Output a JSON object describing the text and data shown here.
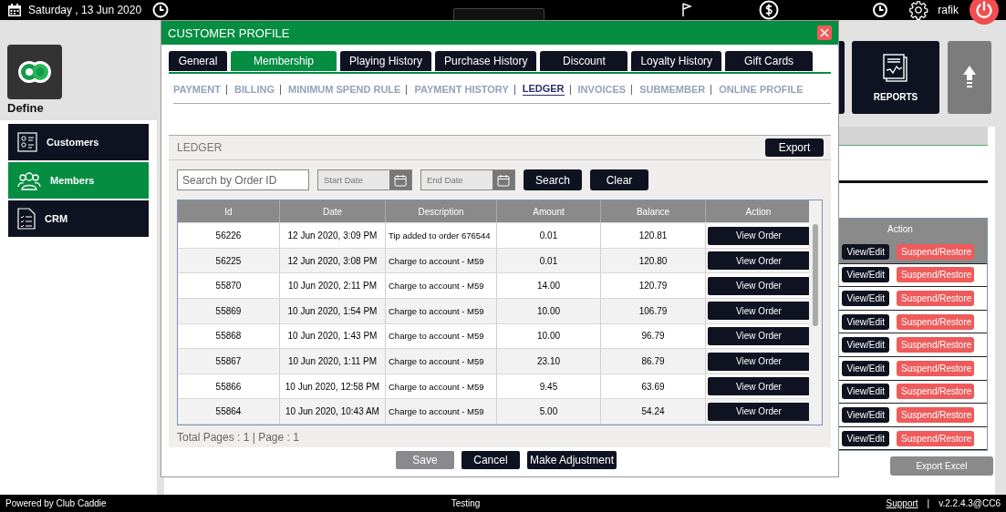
{
  "top_bar": {
    "date": "Saturday ,  13 Jun 2020",
    "user": "rafik"
  },
  "sidebar": {
    "logo_label": "Define",
    "items": [
      {
        "label": "Customers",
        "kind": "card",
        "selected": false
      },
      {
        "label": "Members",
        "kind": "people",
        "selected": true
      },
      {
        "label": "CRM",
        "kind": "checklist",
        "selected": false
      }
    ]
  },
  "tiles": [
    {
      "label": "REPORTS"
    }
  ],
  "members_table": {
    "columns": [
      "Action"
    ],
    "rows": [
      {
        "edit": "View/Edit",
        "suspend": "Suspend/Restore",
        "selected": true
      },
      {
        "edit": "View/Edit",
        "suspend": "Suspend/Restore",
        "selected": false
      },
      {
        "edit": "View/Edit",
        "suspend": "Suspend/Restore",
        "selected": false
      },
      {
        "edit": "View/Edit",
        "suspend": "Suspend/Restore",
        "selected": false
      },
      {
        "edit": "View/Edit",
        "suspend": "Suspend/Restore",
        "selected": false
      },
      {
        "edit": "View/Edit",
        "suspend": "Suspend/Restore",
        "selected": false
      },
      {
        "edit": "View/Edit",
        "suspend": "Suspend/Restore",
        "selected": false
      },
      {
        "edit": "View/Edit",
        "suspend": "Suspend/Restore",
        "selected": false
      },
      {
        "edit": "View/Edit",
        "suspend": "Suspend/Restore",
        "selected": false
      }
    ],
    "export_button": "Export Excel"
  },
  "modal": {
    "title": "CUSTOMER PROFILE",
    "tabs": [
      {
        "label": "General",
        "selected": false
      },
      {
        "label": "Membership",
        "selected": true
      },
      {
        "label": "Playing History",
        "selected": false
      },
      {
        "label": "Purchase History",
        "selected": false
      },
      {
        "label": "Discount",
        "selected": false
      },
      {
        "label": "Loyalty History",
        "selected": false
      },
      {
        "label": "Gift Cards",
        "selected": false
      }
    ],
    "subnav": [
      {
        "label": "PAYMENT",
        "selected": false
      },
      {
        "label": "BILLING",
        "selected": false
      },
      {
        "label": "MINIMUM SPEND RULE",
        "selected": false
      },
      {
        "label": "PAYMENT HISTORY",
        "selected": false
      },
      {
        "label": "LEDGER",
        "selected": true
      },
      {
        "label": "INVOICES",
        "selected": false
      },
      {
        "label": "SUBMEMBER",
        "selected": false
      },
      {
        "label": "ONLINE PROFILE",
        "selected": false
      }
    ],
    "ledger": {
      "title": "LEDGER",
      "export": "Export",
      "search": {
        "placeholder": "Search by Order ID"
      },
      "start_date": {
        "placeholder": "Start Date"
      },
      "end_date": {
        "placeholder": "End Date"
      },
      "search_button": "Search",
      "clear_button": "Clear",
      "table": {
        "columns": [
          "Id",
          "Date",
          "Description",
          "Amount",
          "Balance",
          "Action"
        ],
        "rows": [
          {
            "id": "56226",
            "date": "12 Jun 2020, 3:09 PM",
            "description": "Tip added to order 676544",
            "amount": "0.01",
            "balance": "120.81",
            "action": "View Order"
          },
          {
            "id": "56225",
            "date": "12 Jun 2020, 3:08 PM",
            "description": "Charge to account - M59",
            "amount": "0.01",
            "balance": "120.80",
            "action": "View Order"
          },
          {
            "id": "55870",
            "date": "10 Jun 2020, 2:11 PM",
            "description": "Charge to account - M59",
            "amount": "14.00",
            "balance": "120.79",
            "action": "View Order"
          },
          {
            "id": "55869",
            "date": "10 Jun 2020, 1:54 PM",
            "description": "Charge to account - M59",
            "amount": "10.00",
            "balance": "106.79",
            "action": "View Order"
          },
          {
            "id": "55868",
            "date": "10 Jun 2020, 1:43 PM",
            "description": "Charge to account - M59",
            "amount": "10.00",
            "balance": "96.79",
            "action": "View Order"
          },
          {
            "id": "55867",
            "date": "10 Jun 2020, 1:11 PM",
            "description": "Charge to account - M59",
            "amount": "23.10",
            "balance": "86.79",
            "action": "View Order"
          },
          {
            "id": "55866",
            "date": "10 Jun 2020, 12:58 PM",
            "description": "Charge to account - M59",
            "amount": "9.45",
            "balance": "63.69",
            "action": "View Order"
          },
          {
            "id": "55864",
            "date": "10 Jun 2020, 10:43 AM",
            "description": "Charge to account - M59",
            "amount": "5.00",
            "balance": "54.24",
            "action": "View Order"
          }
        ]
      },
      "pages": "Total Pages : 1 | Page : 1"
    },
    "actions": [
      {
        "label": "Save",
        "disabled": true
      },
      {
        "label": "Cancel",
        "disabled": false
      },
      {
        "label": "Make Adjustment",
        "disabled": false
      }
    ]
  },
  "footer": {
    "left": "Powered by Club Caddie",
    "center": "Testing",
    "support": "Support",
    "separator": "|",
    "version": "v.2.2.4.3@CC6"
  }
}
